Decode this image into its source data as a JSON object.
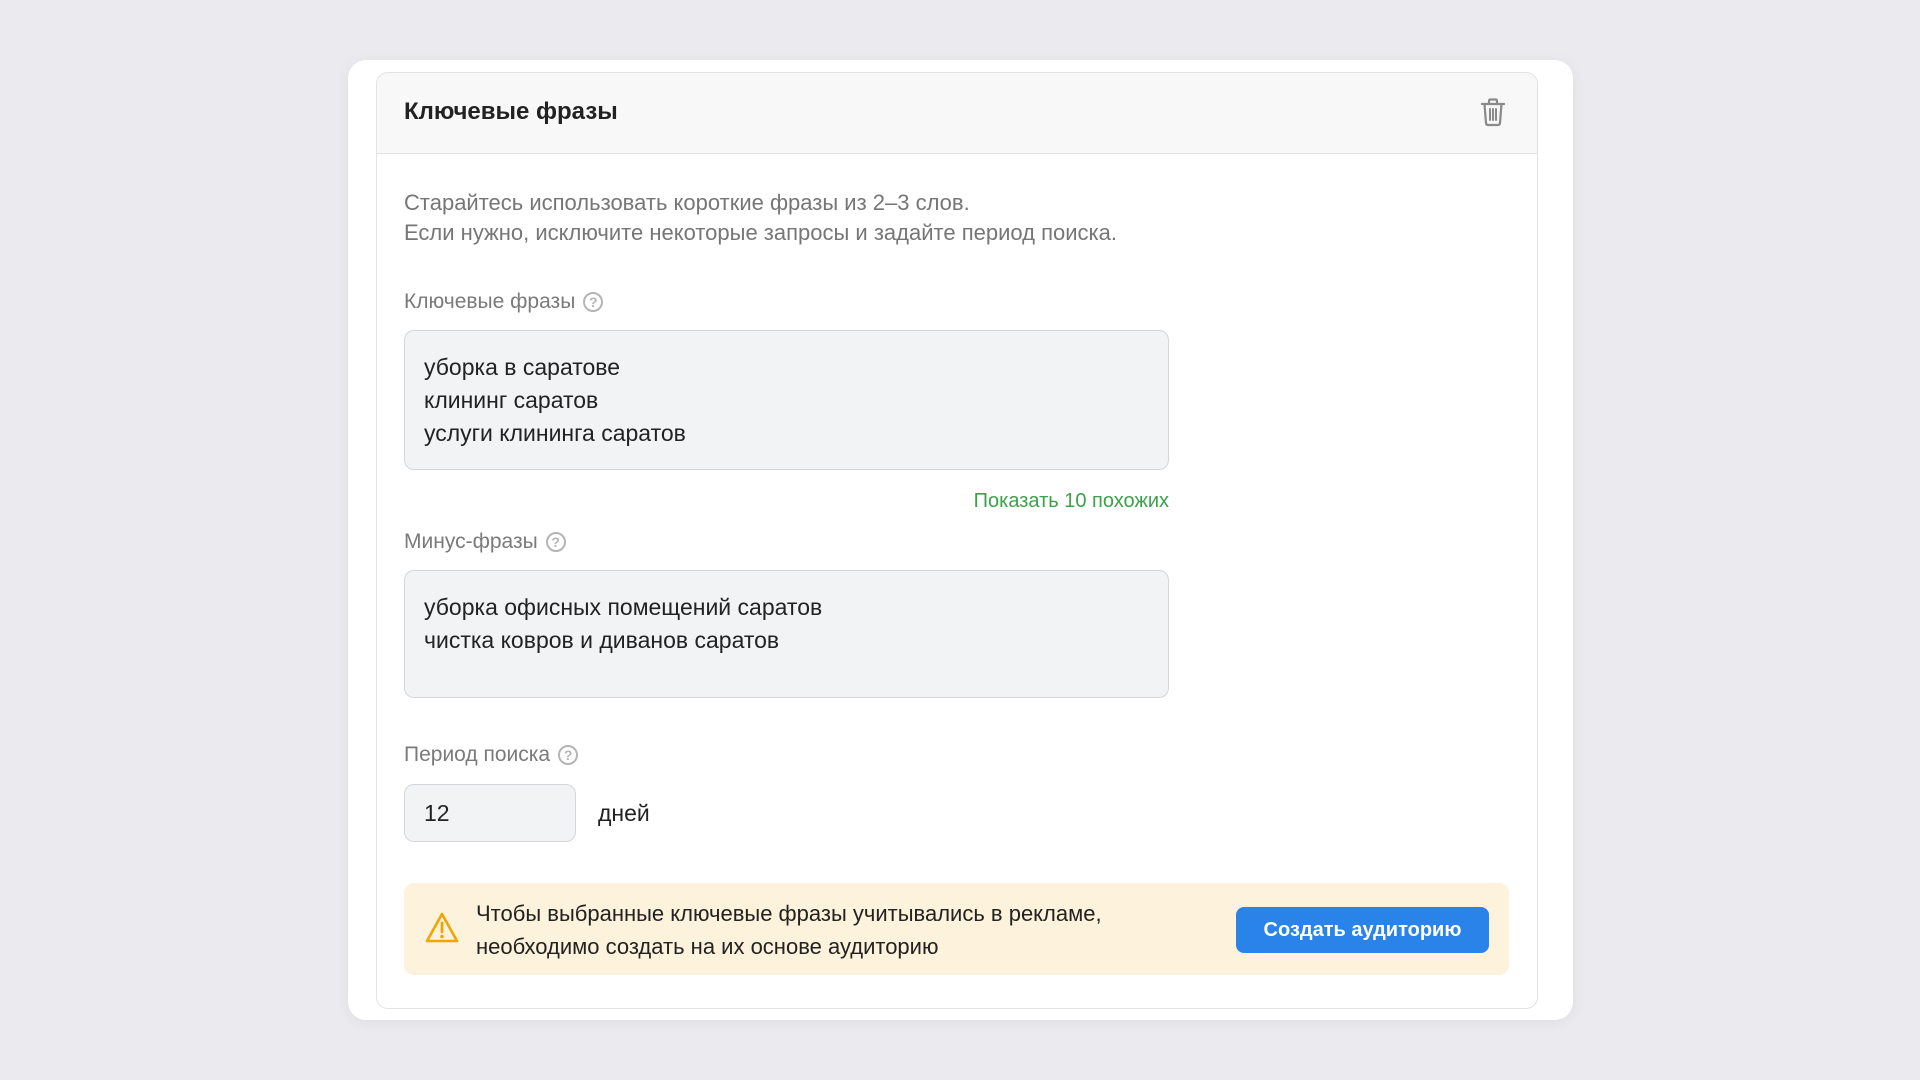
{
  "panel": {
    "title": "Ключевые фразы"
  },
  "hint": {
    "line1": "Старайтесь использовать короткие фразы из 2–3 слов.",
    "line2": "Если нужно, исключите некоторые запросы и задайте период поиска."
  },
  "keywords": {
    "label": "Ключевые фразы",
    "help": "?",
    "lines": [
      "уборка в саратове",
      "клининг саратов",
      "услуги клининга саратов"
    ],
    "similar_link": "Показать 10 похожих"
  },
  "minus": {
    "label": "Минус-фразы",
    "help": "?",
    "lines": [
      "уборка офисных помещений саратов",
      "чистка ковров и диванов саратов"
    ]
  },
  "period": {
    "label": "Период поиска",
    "help": "?",
    "value": "12",
    "unit": "дней"
  },
  "notice": {
    "line1": "Чтобы выбранные ключевые фразы учитывались в рекламе,",
    "line2": "необходимо создать на их основе аудиторию",
    "button": "Создать аудиторию"
  },
  "colors": {
    "accent": "#2a83e8",
    "link": "#3aa34a",
    "warning": "#f0a500",
    "notice_bg": "#fdf2dc"
  },
  "icons": {
    "delete": "trash-icon",
    "help": "question-circle-icon",
    "warning": "warning-triangle-icon"
  }
}
